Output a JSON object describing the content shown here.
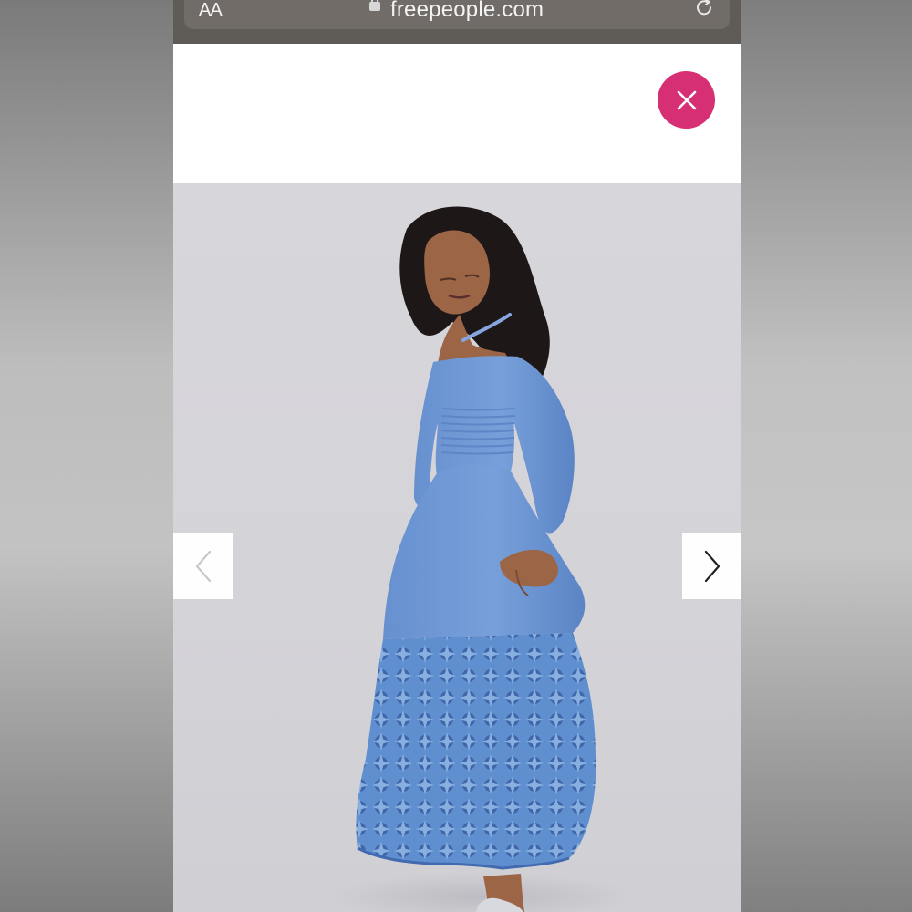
{
  "browser": {
    "text_size_label": "AA",
    "url": "freepeople.com",
    "lock_icon": "lock-icon",
    "refresh_icon": "refresh-icon"
  },
  "product_gallery": {
    "close_icon": "close-icon",
    "prev_icon": "chevron-left-icon",
    "next_icon": "chevron-right-icon",
    "accent_color": "#d72f73",
    "background_color": "#ffffff"
  }
}
